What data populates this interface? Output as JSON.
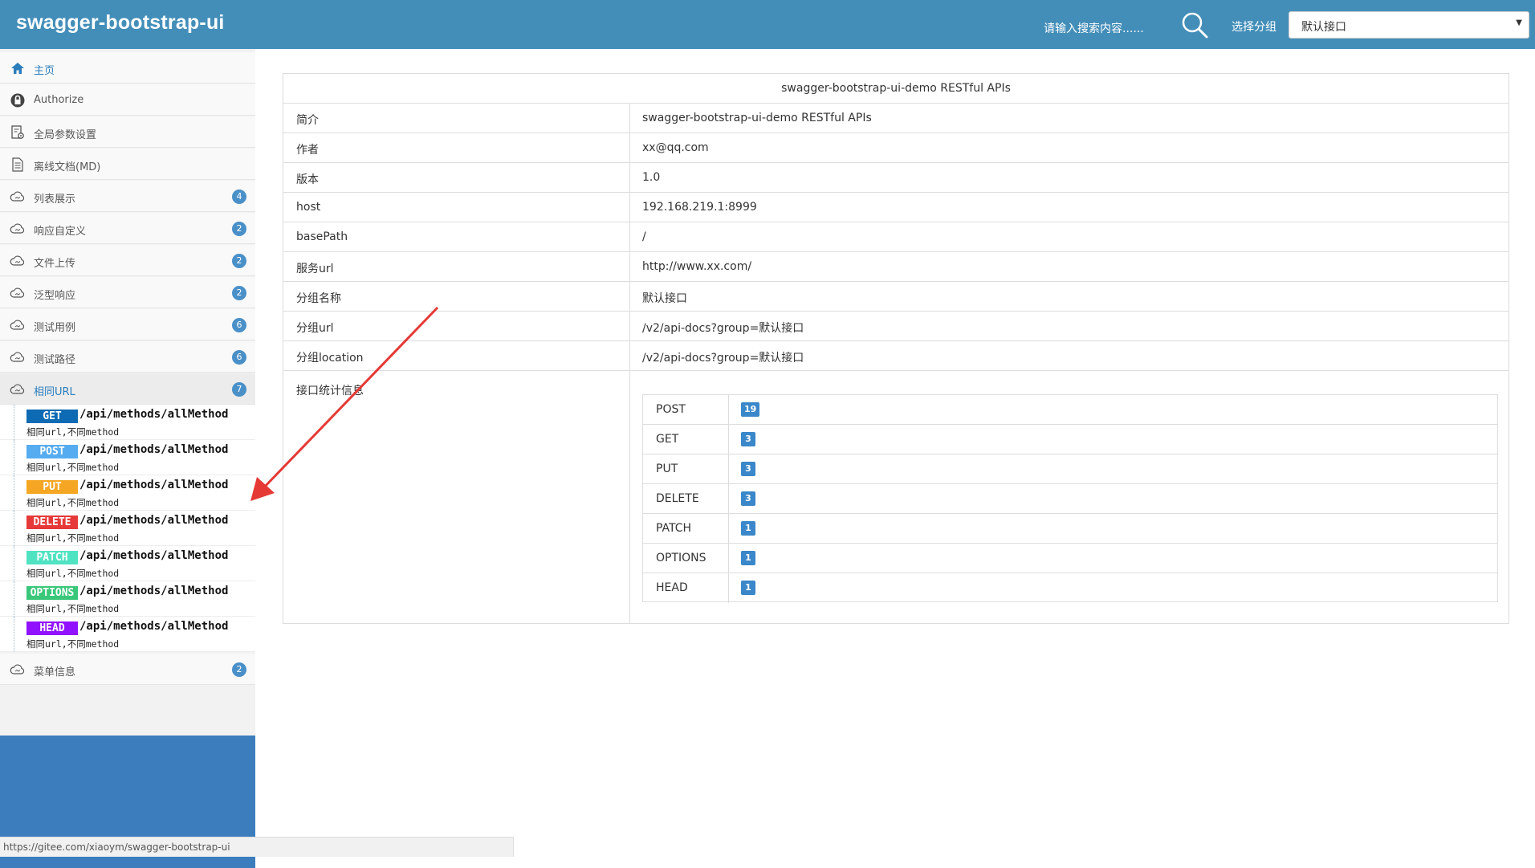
{
  "header": {
    "brand": "swagger-bootstrap-ui",
    "search_placeholder": "请输入搜索内容......",
    "group_label": "选择分组",
    "group_selected": "默认接口"
  },
  "sidebar": {
    "items": [
      {
        "label": "主页",
        "icon": "home-icon"
      },
      {
        "label": "Authorize",
        "icon": "lock-icon"
      },
      {
        "label": "全局参数设置",
        "icon": "settings-doc-icon"
      },
      {
        "label": "离线文档(MD)",
        "icon": "document-icon"
      },
      {
        "label": "列表展示",
        "icon": "cloud-icon",
        "count": "4"
      },
      {
        "label": "响应自定义",
        "icon": "cloud-icon",
        "count": "2"
      },
      {
        "label": "文件上传",
        "icon": "cloud-icon",
        "count": "2"
      },
      {
        "label": "泛型响应",
        "icon": "cloud-icon",
        "count": "2"
      },
      {
        "label": "测试用例",
        "icon": "cloud-icon",
        "count": "6"
      },
      {
        "label": "测试路径",
        "icon": "cloud-icon",
        "count": "6"
      },
      {
        "label": "相同URL",
        "icon": "cloud-icon",
        "count": "7"
      }
    ],
    "sub_items": [
      {
        "method": "GET",
        "path": "/api/methods/allMethod",
        "desc": "相同url,不同method",
        "color": "#0f6ab4"
      },
      {
        "method": "POST",
        "path": "/api/methods/allMethod",
        "desc": "相同url,不同method",
        "color": "#56acf0"
      },
      {
        "method": "PUT",
        "path": "/api/methods/allMethod",
        "desc": "相同url,不同method",
        "color": "#f5a623"
      },
      {
        "method": "DELETE",
        "path": "/api/methods/allMethod",
        "desc": "相同url,不同method",
        "color": "#e63939"
      },
      {
        "method": "PATCH",
        "path": "/api/methods/allMethod",
        "desc": "相同url,不同method",
        "color": "#50e3c2"
      },
      {
        "method": "OPTIONS",
        "path": "/api/methods/allMethod",
        "desc": "相同url,不同method",
        "color": "#3ac77a"
      },
      {
        "method": "HEAD",
        "path": "/api/methods/allMethod",
        "desc": "相同url,不同method",
        "color": "#9012fe"
      }
    ],
    "last_item": {
      "label": "菜单信息",
      "icon": "cloud-icon",
      "count": "2"
    }
  },
  "main": {
    "title": "swagger-bootstrap-ui-demo RESTful APIs",
    "rows": [
      {
        "key": "简介",
        "value": "swagger-bootstrap-ui-demo RESTful APIs"
      },
      {
        "key": "作者",
        "value": "xx@qq.com"
      },
      {
        "key": "版本",
        "value": "1.0"
      },
      {
        "key": "host",
        "value": "192.168.219.1:8999"
      },
      {
        "key": "basePath",
        "value": "/"
      },
      {
        "key": "服务url",
        "value": "http://www.xx.com/"
      },
      {
        "key": "分组名称",
        "value": "默认接口"
      },
      {
        "key": "分组url",
        "value": "/v2/api-docs?group=默认接口"
      },
      {
        "key": "分组location",
        "value": "/v2/api-docs?group=默认接口"
      }
    ],
    "stats_label": "接口统计信息",
    "stats": [
      {
        "method": "POST",
        "count": "19"
      },
      {
        "method": "GET",
        "count": "3"
      },
      {
        "method": "PUT",
        "count": "3"
      },
      {
        "method": "DELETE",
        "count": "3"
      },
      {
        "method": "PATCH",
        "count": "1"
      },
      {
        "method": "OPTIONS",
        "count": "1"
      },
      {
        "method": "HEAD",
        "count": "1"
      }
    ]
  },
  "statusbar": {
    "url": "https://gitee.com/xiaoym/swagger-bootstrap-ui"
  },
  "colors": {
    "header": "#438eb9",
    "badge": "#3a87c9",
    "annotation_arrow": "#e53935"
  }
}
